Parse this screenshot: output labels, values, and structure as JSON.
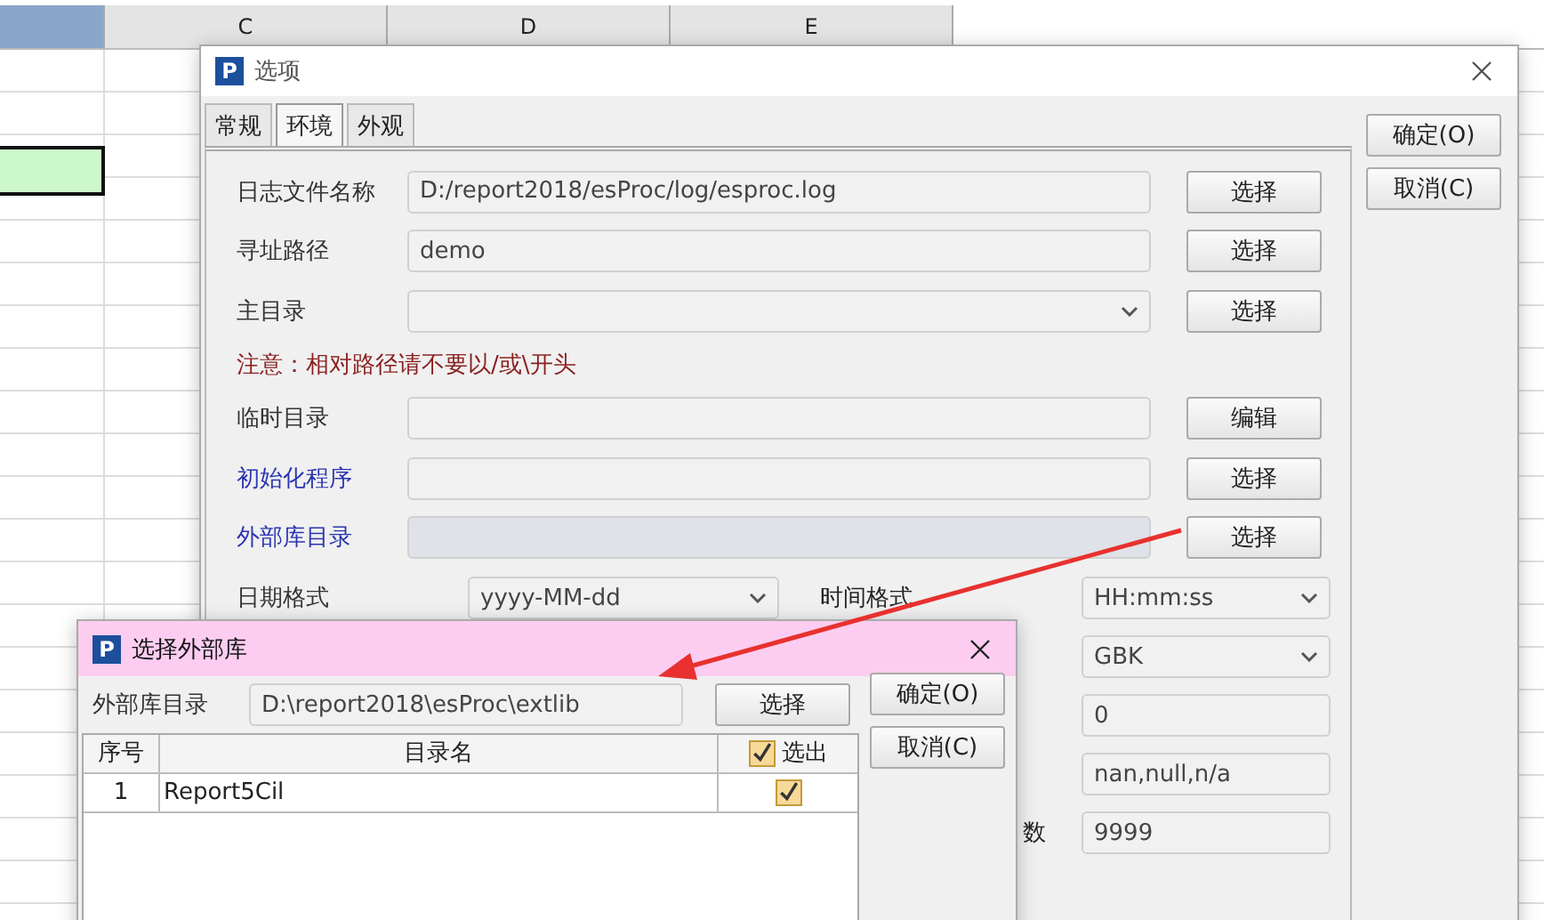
{
  "spreadsheet": {
    "columns": [
      "C",
      "D",
      "E"
    ]
  },
  "options_dialog": {
    "logo": "P",
    "title": "选项",
    "tabs": [
      {
        "label": "常规",
        "selected": false
      },
      {
        "label": "环境",
        "selected": true
      },
      {
        "label": "外观",
        "selected": false
      }
    ],
    "buttons": [
      "确定(O)",
      "取消(C)"
    ],
    "rows": [
      {
        "label": "日志文件名称",
        "value": "D:/report2018/esProc/log/esproc.log",
        "kind": "text",
        "emphasis": false,
        "disabled": false,
        "button": "选择"
      },
      {
        "label": "寻址路径",
        "value": "demo",
        "kind": "text",
        "emphasis": false,
        "disabled": false,
        "button": "选择"
      },
      {
        "label": "主目录",
        "kind": "dropdown",
        "emphasis": false,
        "disabled": false,
        "button": "选择"
      },
      {
        "kind": "note",
        "label": "注意：相对路径请不要以/或\\开头"
      },
      {
        "label": "临时目录",
        "kind": "text",
        "emphasis": false,
        "disabled": false,
        "button": "编辑"
      },
      {
        "label": "初始化程序",
        "kind": "text",
        "emphasis": true,
        "disabled": false,
        "button": "选择"
      },
      {
        "label": "外部库目录",
        "kind": "text",
        "emphasis": true,
        "disabled": true,
        "button": "选择"
      }
    ],
    "date_format": {
      "label": "日期格式",
      "value": "yyyy-MM-dd"
    },
    "right_fields": [
      {
        "label": "时间格式",
        "value": "HH:mm:ss",
        "kind": "dropdown"
      },
      {
        "value": "GBK",
        "kind": "dropdown"
      },
      {
        "value": "0",
        "kind": "text"
      },
      {
        "value": "nan,null,n/a",
        "kind": "text"
      },
      {
        "label": "数",
        "value": "9999",
        "kind": "text"
      }
    ]
  },
  "library_dialog": {
    "logo": "P",
    "title": "选择外部库",
    "label": "外部库目录",
    "path": "D:\\report2018\\esProc\\extlib",
    "browse_button": "选择",
    "buttons": [
      "确定(O)",
      "取消(C)"
    ],
    "columns": [
      "序号",
      "目录名",
      "选出"
    ],
    "header_checked": true,
    "rows": [
      {
        "index": "1",
        "name": "Report5Cil",
        "checked": true
      }
    ]
  }
}
